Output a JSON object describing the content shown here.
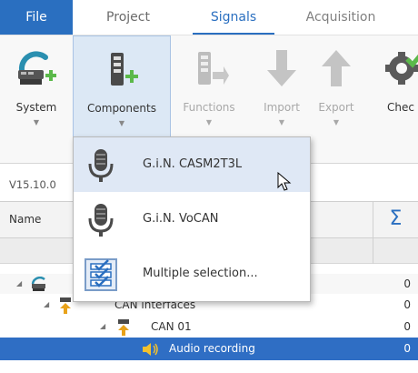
{
  "tabs": [
    {
      "label": "File",
      "state": "accent"
    },
    {
      "label": "Project",
      "state": "normal"
    },
    {
      "label": "Signals",
      "state": "active"
    },
    {
      "label": "Acquisition",
      "state": "normal"
    }
  ],
  "ribbon": {
    "system": {
      "label": "System",
      "icon": "system-add-icon",
      "has_dropdown": true
    },
    "components": {
      "label": "Components",
      "icon": "component-add-icon",
      "has_dropdown": true,
      "state": "pressed"
    },
    "functions": {
      "label": "Functions",
      "icon": "functions-add-icon",
      "has_dropdown": true,
      "state": "disabled"
    },
    "import": {
      "label": "Import",
      "icon": "import-arrow-icon",
      "has_dropdown": true,
      "state": "disabled"
    },
    "export": {
      "label": "Export",
      "icon": "export-arrow-icon",
      "has_dropdown": true,
      "state": "disabled"
    },
    "check": {
      "label": "Chec",
      "icon": "check-gear-icon"
    }
  },
  "version": "V15.10.0",
  "grid": {
    "header": {
      "name": "Name",
      "sum_symbol": "Σ"
    },
    "rows": [
      {
        "label": "",
        "value": "0",
        "icon": "device-icon",
        "indent": 0,
        "expanded": true
      },
      {
        "label": "CAN interfaces",
        "value": "0",
        "icon": "connector-icon",
        "indent": 1,
        "expanded": true
      },
      {
        "label": "CAN 01",
        "value": "0",
        "icon": "connector-icon",
        "indent": 2,
        "expanded": true
      },
      {
        "label": "Audio recording",
        "value": "0",
        "icon": "speaker-icon",
        "indent": 3,
        "selected": true
      }
    ]
  },
  "dropdown": {
    "items": [
      {
        "label": "G.i.N. CASM2T3L",
        "icon": "microphone-icon",
        "highlighted": true
      },
      {
        "label": "G.i.N. VoCAN",
        "icon": "microphone-icon"
      },
      {
        "label": "Multiple selection...",
        "icon": "multi-select-checklist-icon"
      }
    ]
  },
  "colors": {
    "accent": "#2a6fc0",
    "selection": "#2f6ec4",
    "hover": "#dfe8f5",
    "add_green": "#5bb94a"
  }
}
